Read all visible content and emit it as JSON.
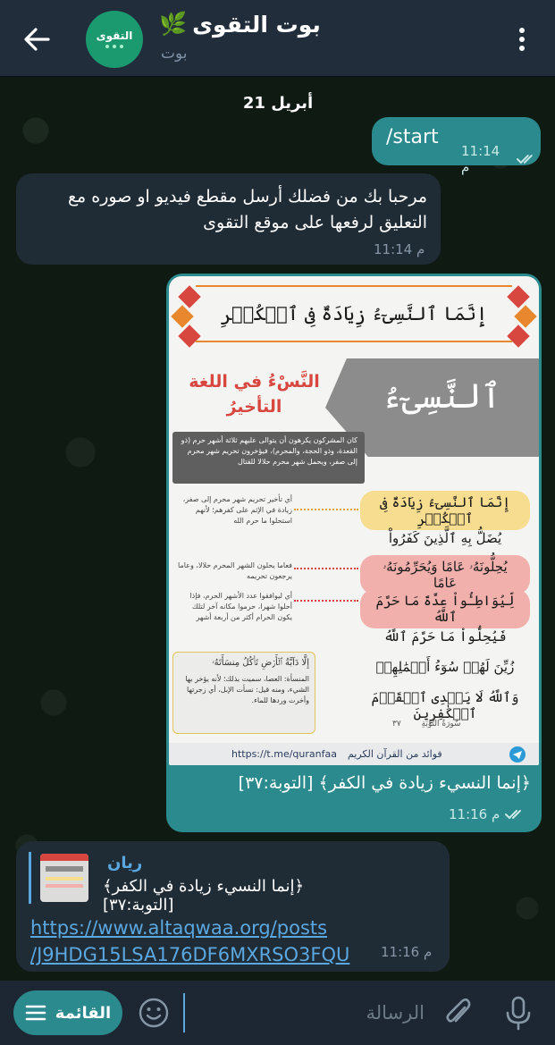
{
  "header": {
    "title": "بوت التقوى",
    "title_emoji": "🌿",
    "subtitle": "بوت",
    "avatar_text": "التقوى"
  },
  "chat": {
    "date_separator": "21 أبريل",
    "messages": [
      {
        "direction": "out",
        "text": "/start",
        "time": "11:14 م",
        "status": "read"
      },
      {
        "direction": "in",
        "text": "مرحبا بك من فضلك أرسل مقطع فيديو او صوره مع التعليق لرفعها على موقع التقوى",
        "time": "11:14 م"
      },
      {
        "direction": "out",
        "type": "image",
        "caption": "﴿إنما النسيء زيادة في الكفر﴾ [التوبة:٣٧]",
        "time": "11:16 م",
        "status": "read",
        "image": {
          "banner_verse": "إِنَّمَا ٱلنَّسِىٓءُ زِيَادَةٌ فِى ٱلۡكُفۡرِ",
          "big_word": "ٱلنَّسِىٓءُ",
          "side_title_line1": "النَّسْءُ في اللغة",
          "side_title_line2": "التأخيرُ",
          "dark_note": "كان المشركون يكرهون أن يتوالى عليهم ثلاثة أشهر حرم (ذو القعدة، وذو الحجة، والمحرم)، فيؤخرون تحريم شهر محرم إلى صفر، ويحمل شهر محرم حلالا للقتال",
          "note1": "أي تأخير تحريم شهر محرم إلى صفر، زيادة في الإثم على كفرهم؛ لأنهم استحلوا ما حرم الله",
          "note2": "فعاما يحلون الشهر المحرم حلالا، وعاما يرجعون تحريمه",
          "note3": "أي ليوافقوا عدد الأشهر الحرم، فإذا أحلوا شهرا، حرموا مكانه آخر لتلك يكون الحرام أكثر من أربعة أشهر",
          "verse1": "إِنَّمَا ٱلنَّسِىٓءُ زِيَادَةٌ فِى ٱلۡكُفۡرِ",
          "verse2": "يُضَلُّ بِهِ ٱلَّذِينَ كَفَرُواْ",
          "verse3": "يُحِلُّونَهُۥ عَامًا وَيُحَرِّمُونَهُۥ عَامًا",
          "verse4": "لِّيُوَاطِـُٔواْ عِدَّةَ مَا حَرَّمَ ٱللَّهُ",
          "verse5": "فَيُحِلُّواْ مَا حَرَّمَ ٱللَّهُ",
          "verse6": "زُيِّنَ لَهُمۡ سُوٓءُ أَعۡمَٰلِهِمۡ",
          "verse7": "وَٱللَّهُ لَا يَهۡدِى ٱلۡقَوۡمَ ٱلۡكَٰفِرِينَ",
          "surah_label": "سُورَةُ التَّوْبَةِ",
          "verse_number": "٣٧",
          "corner_verse": "إِلَّا دَآبَّةُ ٱلۡأَرۡضِ تَأۡكُلُ مِنسَأَتَهُۥ",
          "corner_note": "المنسأة: العصا، سميت بذلك؛ لأنه يؤخر بها الشيء، ومنه قيل: نسأت الإبل، أي زجرتها وأخرت وردها للماء.",
          "footer_url": "https://t.me/quranfaa",
          "footer_text": "فوائد من القرآن الكريم"
        }
      },
      {
        "direction": "in",
        "type": "reply",
        "reply_name": "ريان",
        "reply_text": "﴿إنما النسيء زيادة في الكفر﴾ [التوبة:٣٧]",
        "link_line1": "https://www.altaqwaa.org/posts",
        "link_line2": "/J9HDG15LSA176DF6MXRSO3FQU",
        "time": "11:16 م"
      }
    ]
  },
  "input_bar": {
    "menu_label": "القائمة",
    "placeholder": "الرسالة"
  },
  "colors": {
    "header_bg": "#212d3b",
    "outgoing_bubble": "#2b8a8d",
    "incoming_bubble": "#1f2c36",
    "link": "#5ba7e0",
    "accent_red": "#d8473f",
    "accent_orange": "#e8872d"
  }
}
